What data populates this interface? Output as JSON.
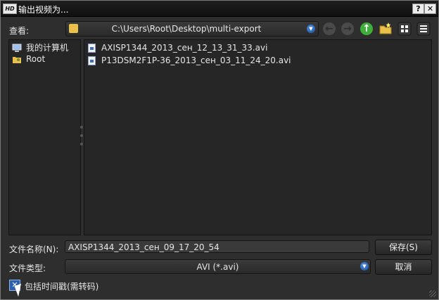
{
  "window": {
    "title": "输出视频为...",
    "app_icon_text": "HD",
    "help_glyph": "?",
    "close_glyph": "✕"
  },
  "lookin": {
    "label": "查看:",
    "path": "C:\\Users\\Root\\Desktop\\multi-export"
  },
  "toolbar": {
    "back_icon": "back-arrow-icon",
    "forward_icon": "forward-arrow-icon",
    "up_icon": "up-arrow-icon",
    "new_folder_icon": "new-folder-icon",
    "icon_view_icon": "grid-view-icon",
    "list_view_icon": "list-view-icon"
  },
  "places": [
    {
      "label": "我的计算机",
      "icon": "computer-icon"
    },
    {
      "label": "Root",
      "icon": "user-folder-icon"
    }
  ],
  "files": [
    {
      "name": "AXISP1344_2013_сен_12_13_31_33.avi",
      "icon": "video-file-icon"
    },
    {
      "name": "P13DSM2F1P-36_2013_сен_03_11_24_20.avi",
      "icon": "video-file-icon"
    }
  ],
  "filename": {
    "label": "文件名称(N):",
    "value": "AXISP1344_2013_сен_09_17_20_54"
  },
  "filetype": {
    "label": "文件类型:",
    "value": "AVI (*.avi)"
  },
  "buttons": {
    "save": "保存(S)",
    "cancel": "取消"
  },
  "timestamp_checkbox": {
    "label": "包括时间戳(需转码)",
    "checked": true
  },
  "colors": {
    "accent": "#2a5fae",
    "background": "#2e2e2e",
    "folder": "#e8c04a",
    "up_arrow": "#3fae3a"
  }
}
